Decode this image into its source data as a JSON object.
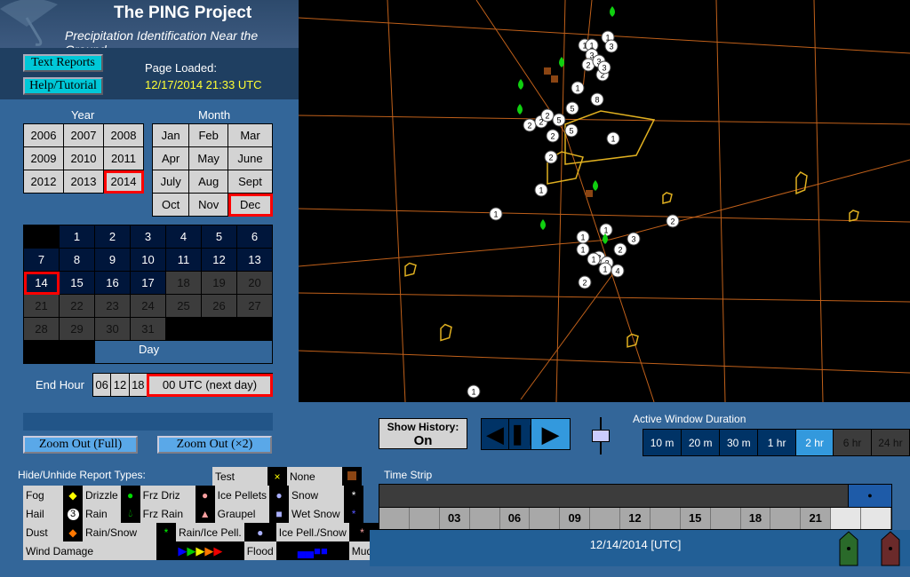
{
  "header": {
    "title": "The PING Project",
    "subtitle": "Precipitation Identification Near the Ground"
  },
  "buttons": {
    "text_reports": "Text Reports",
    "help": "Help/Tutorial",
    "zoom_full": "Zoom Out (Full)",
    "zoom_x2": "Zoom Out (×2)"
  },
  "page_loaded": {
    "label": "Page Loaded:",
    "value": "12/17/2014 21:33 UTC"
  },
  "year": {
    "label": "Year",
    "options": [
      "2006",
      "2007",
      "2008",
      "2009",
      "2010",
      "2011",
      "2012",
      "2013",
      "2014"
    ],
    "selected": "2014"
  },
  "month": {
    "label": "Month",
    "options": [
      "Jan",
      "Feb",
      "Mar",
      "Apr",
      "May",
      "June",
      "July",
      "Aug",
      "Sept",
      "Oct",
      "Nov",
      "Dec"
    ],
    "selected": "Dec"
  },
  "day": {
    "label": "Day",
    "selected": 14,
    "last_available": 17,
    "days_in_month": 31,
    "first_weekday": 1
  },
  "end_hour": {
    "label": "End Hour",
    "options": [
      "06",
      "12",
      "18",
      "00 UTC (next day)"
    ],
    "selected": "00 UTC (next day)"
  },
  "legend": {
    "title": "Hide/Unhide Report Types:",
    "test": "Test",
    "none": "None",
    "fog": "Fog",
    "drizzle": "Drizzle",
    "frz_driz": "Frz Driz",
    "ice_pellets": "Ice Pellets",
    "snow": "Snow",
    "hail": "Hail",
    "hail_num": "3",
    "rain": "Rain",
    "frz_rain": "Frz Rain",
    "graupel": "Graupel",
    "wet_snow": "Wet Snow",
    "dust": "Dust",
    "rain_snow": "Rain/Snow",
    "rain_ice": "Rain/Ice Pell.",
    "ice_snow": "Ice Pell./Snow",
    "wind": "Wind Damage",
    "flood": "Flood",
    "mud": "Mud"
  },
  "controls": {
    "history_label": "Show History:",
    "history_value": "On",
    "duration_label": "Active Window Duration",
    "durations": [
      "10 m",
      "20 m",
      "30 m",
      "1 hr",
      "2 hr",
      "6 hr",
      "24 hr"
    ],
    "duration_selected": "2 hr",
    "disabled": [
      "6 hr",
      "24 hr"
    ]
  },
  "timestrip": {
    "label": "Time Strip",
    "ticks": [
      "",
      "",
      "03",
      "",
      "06",
      "",
      "09",
      "",
      "12",
      "",
      "15",
      "",
      "18",
      "",
      "21",
      "",
      ""
    ],
    "date": "12/14/2014 [UTC]"
  },
  "map": {
    "markers": [
      "1",
      "1",
      "3",
      "1",
      "3",
      "2",
      "2",
      "3",
      "1",
      "3",
      "5",
      "8",
      "2",
      "2",
      "2",
      "5",
      "5",
      "2",
      "2",
      "1",
      "1",
      "1",
      "2",
      "1",
      "1",
      "3",
      "1",
      "2",
      "2",
      "2",
      "4",
      "1",
      "2",
      "1",
      "1"
    ]
  }
}
